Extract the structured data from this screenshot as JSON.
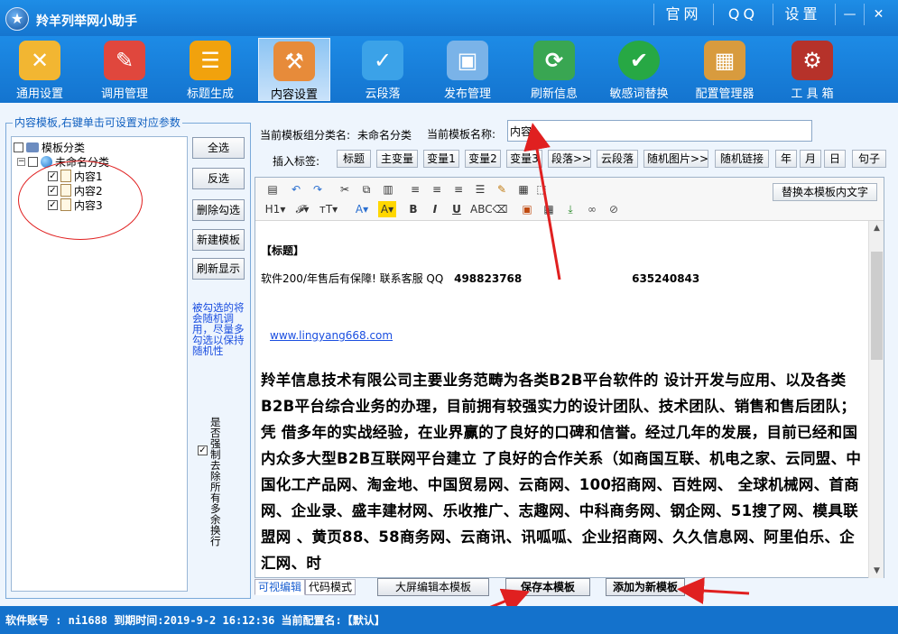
{
  "app": {
    "title": "羚羊列举网小助手",
    "top_links": [
      "官网",
      "QQ",
      "设置"
    ],
    "window_controls": [
      "minimize",
      "close"
    ]
  },
  "toolbar": {
    "items": [
      {
        "label": "通用设置",
        "icon": "wrench-tools-icon",
        "color": "#f2b632"
      },
      {
        "label": "调用管理",
        "icon": "notebook-pen-icon",
        "color": "#e0473d"
      },
      {
        "label": "标题生成",
        "icon": "list-icon",
        "color": "#f1a20d"
      },
      {
        "label": "内容设置",
        "icon": "folder-hammer-icon",
        "color": "#e78b3a",
        "active": true
      },
      {
        "label": "云段落",
        "icon": "cloud-check-icon",
        "color": "#3ba2e8"
      },
      {
        "label": "发布管理",
        "icon": "computer-publish-icon",
        "color": "#7ab3e8"
      },
      {
        "label": "刷新信息",
        "icon": "refresh-icon",
        "color": "#39a652"
      },
      {
        "label": "敏感词替换",
        "icon": "shield-check-icon",
        "color": "#27a844"
      },
      {
        "label": "配置管理器",
        "icon": "box-icon",
        "color": "#d89b3e"
      },
      {
        "label": "工 具 箱",
        "icon": "toolbox-icon",
        "color": "#b6322a"
      }
    ]
  },
  "left_panel": {
    "group_title": "内容模板,右键单击可设置对应参数",
    "tree": {
      "root_label": "模板分类",
      "category_label": "未命名分类",
      "items": [
        {
          "label": "内容1",
          "checked": true
        },
        {
          "label": "内容2",
          "checked": true
        },
        {
          "label": "内容3",
          "checked": true
        }
      ]
    },
    "buttons": {
      "select_all": "全选",
      "invert": "反选",
      "delete_checked": "删除勾选",
      "new_template": "新建模板",
      "refresh": "刷新显示"
    },
    "note": "被勾选的将会随机调用，尽量多勾选以保持随机性",
    "strip_newlines_label": "是否强制去除所有多余换行",
    "strip_newlines_checked": true
  },
  "editor_header": {
    "group_label": "当前模板组分类名:",
    "group_value": "未命名分类",
    "name_label": "当前模板名称:",
    "name_value": "内容1",
    "insert_label": "插入标签:",
    "tags": [
      "标题",
      "主变量",
      "变量1",
      "变量2",
      "变量3",
      "段落>>",
      "云段落",
      "随机图片>>",
      "随机链接",
      "年",
      "月",
      "日",
      "句子"
    ]
  },
  "editor": {
    "replace_button": "替换本模板内文字",
    "heading_tag": "【标题】",
    "contact_line": "软件200/年售后有保障! 联系客服 QQ",
    "qq1": "498823768",
    "qq2": "635240843",
    "link": "www.lingyang668.com",
    "body_text": "羚羊信息技术有限公司主要业务范畴为各类B2B平台软件的 设计开发与应用、以及各类B2B平台综合业务的办理，目前拥有较强实力的设计团队、技术团队、销售和售后团队；凭 借多年的实战经验，在业界赢的了良好的口碑和信誉。经过几年的发展，目前已经和国内众多大型B2B互联网平台建立 了良好的合作关系（如商国互联、机电之家、云同盟、中国化工产品网、淘金地、中国贸易网、云商网、100招商网、百姓网、 全球机械网、首商网、企业录、盛丰建材网、乐收推广、志趣网、中科商务网、钢企网、51搜了网、模具联盟网 、黄页88、58商务网、云商讯、讯呱呱、企业招商网、久久信息网、阿里伯乐、企汇网、时"
  },
  "bottom": {
    "tabs": [
      "可视编辑",
      "代码模式"
    ],
    "fullscreen_button": "大屏编辑本模板",
    "save_button": "保存本模板",
    "add_new_button": "添加为新模板"
  },
  "status_bar": {
    "text": "软件账号 : ni1688  到期时间:2019-9-2 16:12:36  当前配置名:【默认】"
  },
  "colors": {
    "titlebar": "#1e8de6",
    "status": "#1472cc",
    "annotation_red": "#e02020",
    "link_blue": "#1a4ee0"
  }
}
